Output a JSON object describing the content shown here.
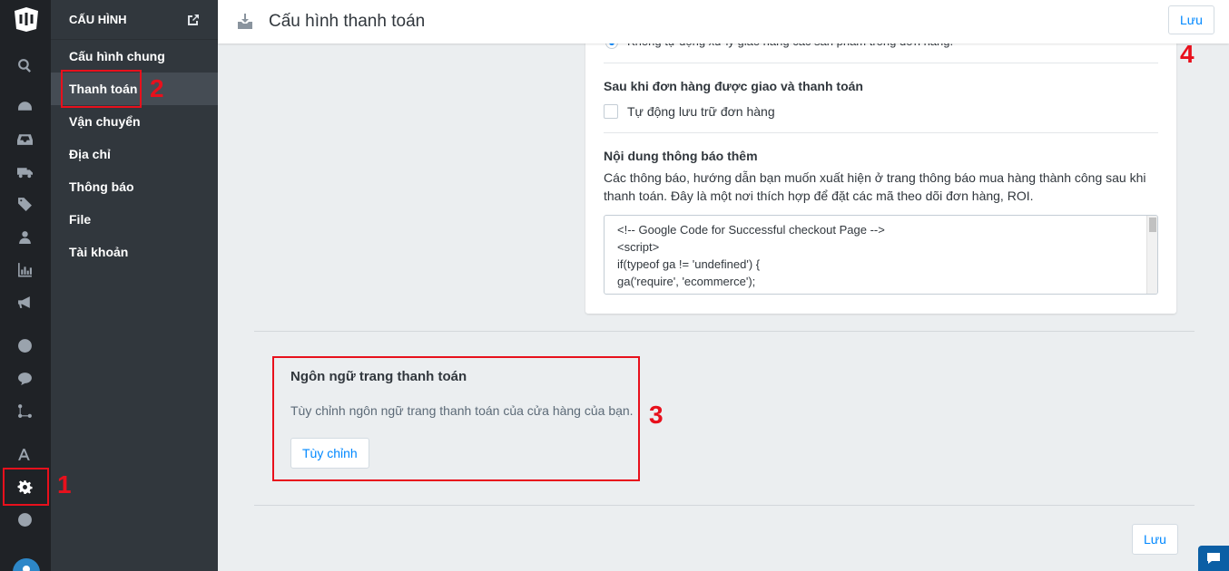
{
  "sidebar": {
    "header": "CẤU HÌNH",
    "items": [
      {
        "label": "Cấu hình chung"
      },
      {
        "label": "Thanh toán"
      },
      {
        "label": "Vận chuyển"
      },
      {
        "label": "Địa chỉ"
      },
      {
        "label": "Thông báo"
      },
      {
        "label": "File"
      },
      {
        "label": "Tài khoản"
      }
    ]
  },
  "topbar": {
    "title": "Cấu hình thanh toán",
    "save_label": "Lưu"
  },
  "card": {
    "cut_option": "Không tự động xử lý giao hàng các sản phẩm trong đơn hàng.",
    "after_delivery_label": "Sau khi đơn hàng được giao và thanh toán",
    "auto_archive_label": "Tự động lưu trữ đơn hàng",
    "extra_content_label": "Nội dung thông báo thêm",
    "extra_content_desc": "Các thông báo, hướng dẫn bạn muốn xuất hiện ở trang thông báo mua hàng thành công sau khi thanh toán. Đây là một nơi thích hợp để đặt các mã theo dõi đơn hàng, ROI.",
    "code_lines": [
      "<!-- Google Code for Successful checkout Page -->",
      "<script>",
      "if(typeof ga != 'undefined') {",
      "ga('require', 'ecommerce');"
    ]
  },
  "language_section": {
    "title": "Ngôn ngữ trang thanh toán",
    "desc": "Tùy chỉnh ngôn ngữ trang thanh toán của cửa hàng của bạn.",
    "button_label": "Tùy chỉnh"
  },
  "footer": {
    "save_label": "Lưu"
  },
  "annotations": {
    "n1": "1",
    "n2": "2",
    "n3": "3",
    "n4": "4"
  },
  "colors": {
    "accent": "#0088ff",
    "annotation": "#e8101c",
    "sidebar_bg": "#31373d",
    "rail_bg": "#1f2226"
  },
  "icons": {
    "rail": [
      "logo-icon",
      "search-icon",
      "dashboard-icon",
      "inbox-icon",
      "truck-icon",
      "tag-icon",
      "users-icon",
      "bar-chart-icon",
      "megaphone-icon",
      "globe-icon",
      "comment-icon",
      "share-nodes-icon",
      "apps-icon",
      "gear-icon",
      "help-icon"
    ]
  }
}
